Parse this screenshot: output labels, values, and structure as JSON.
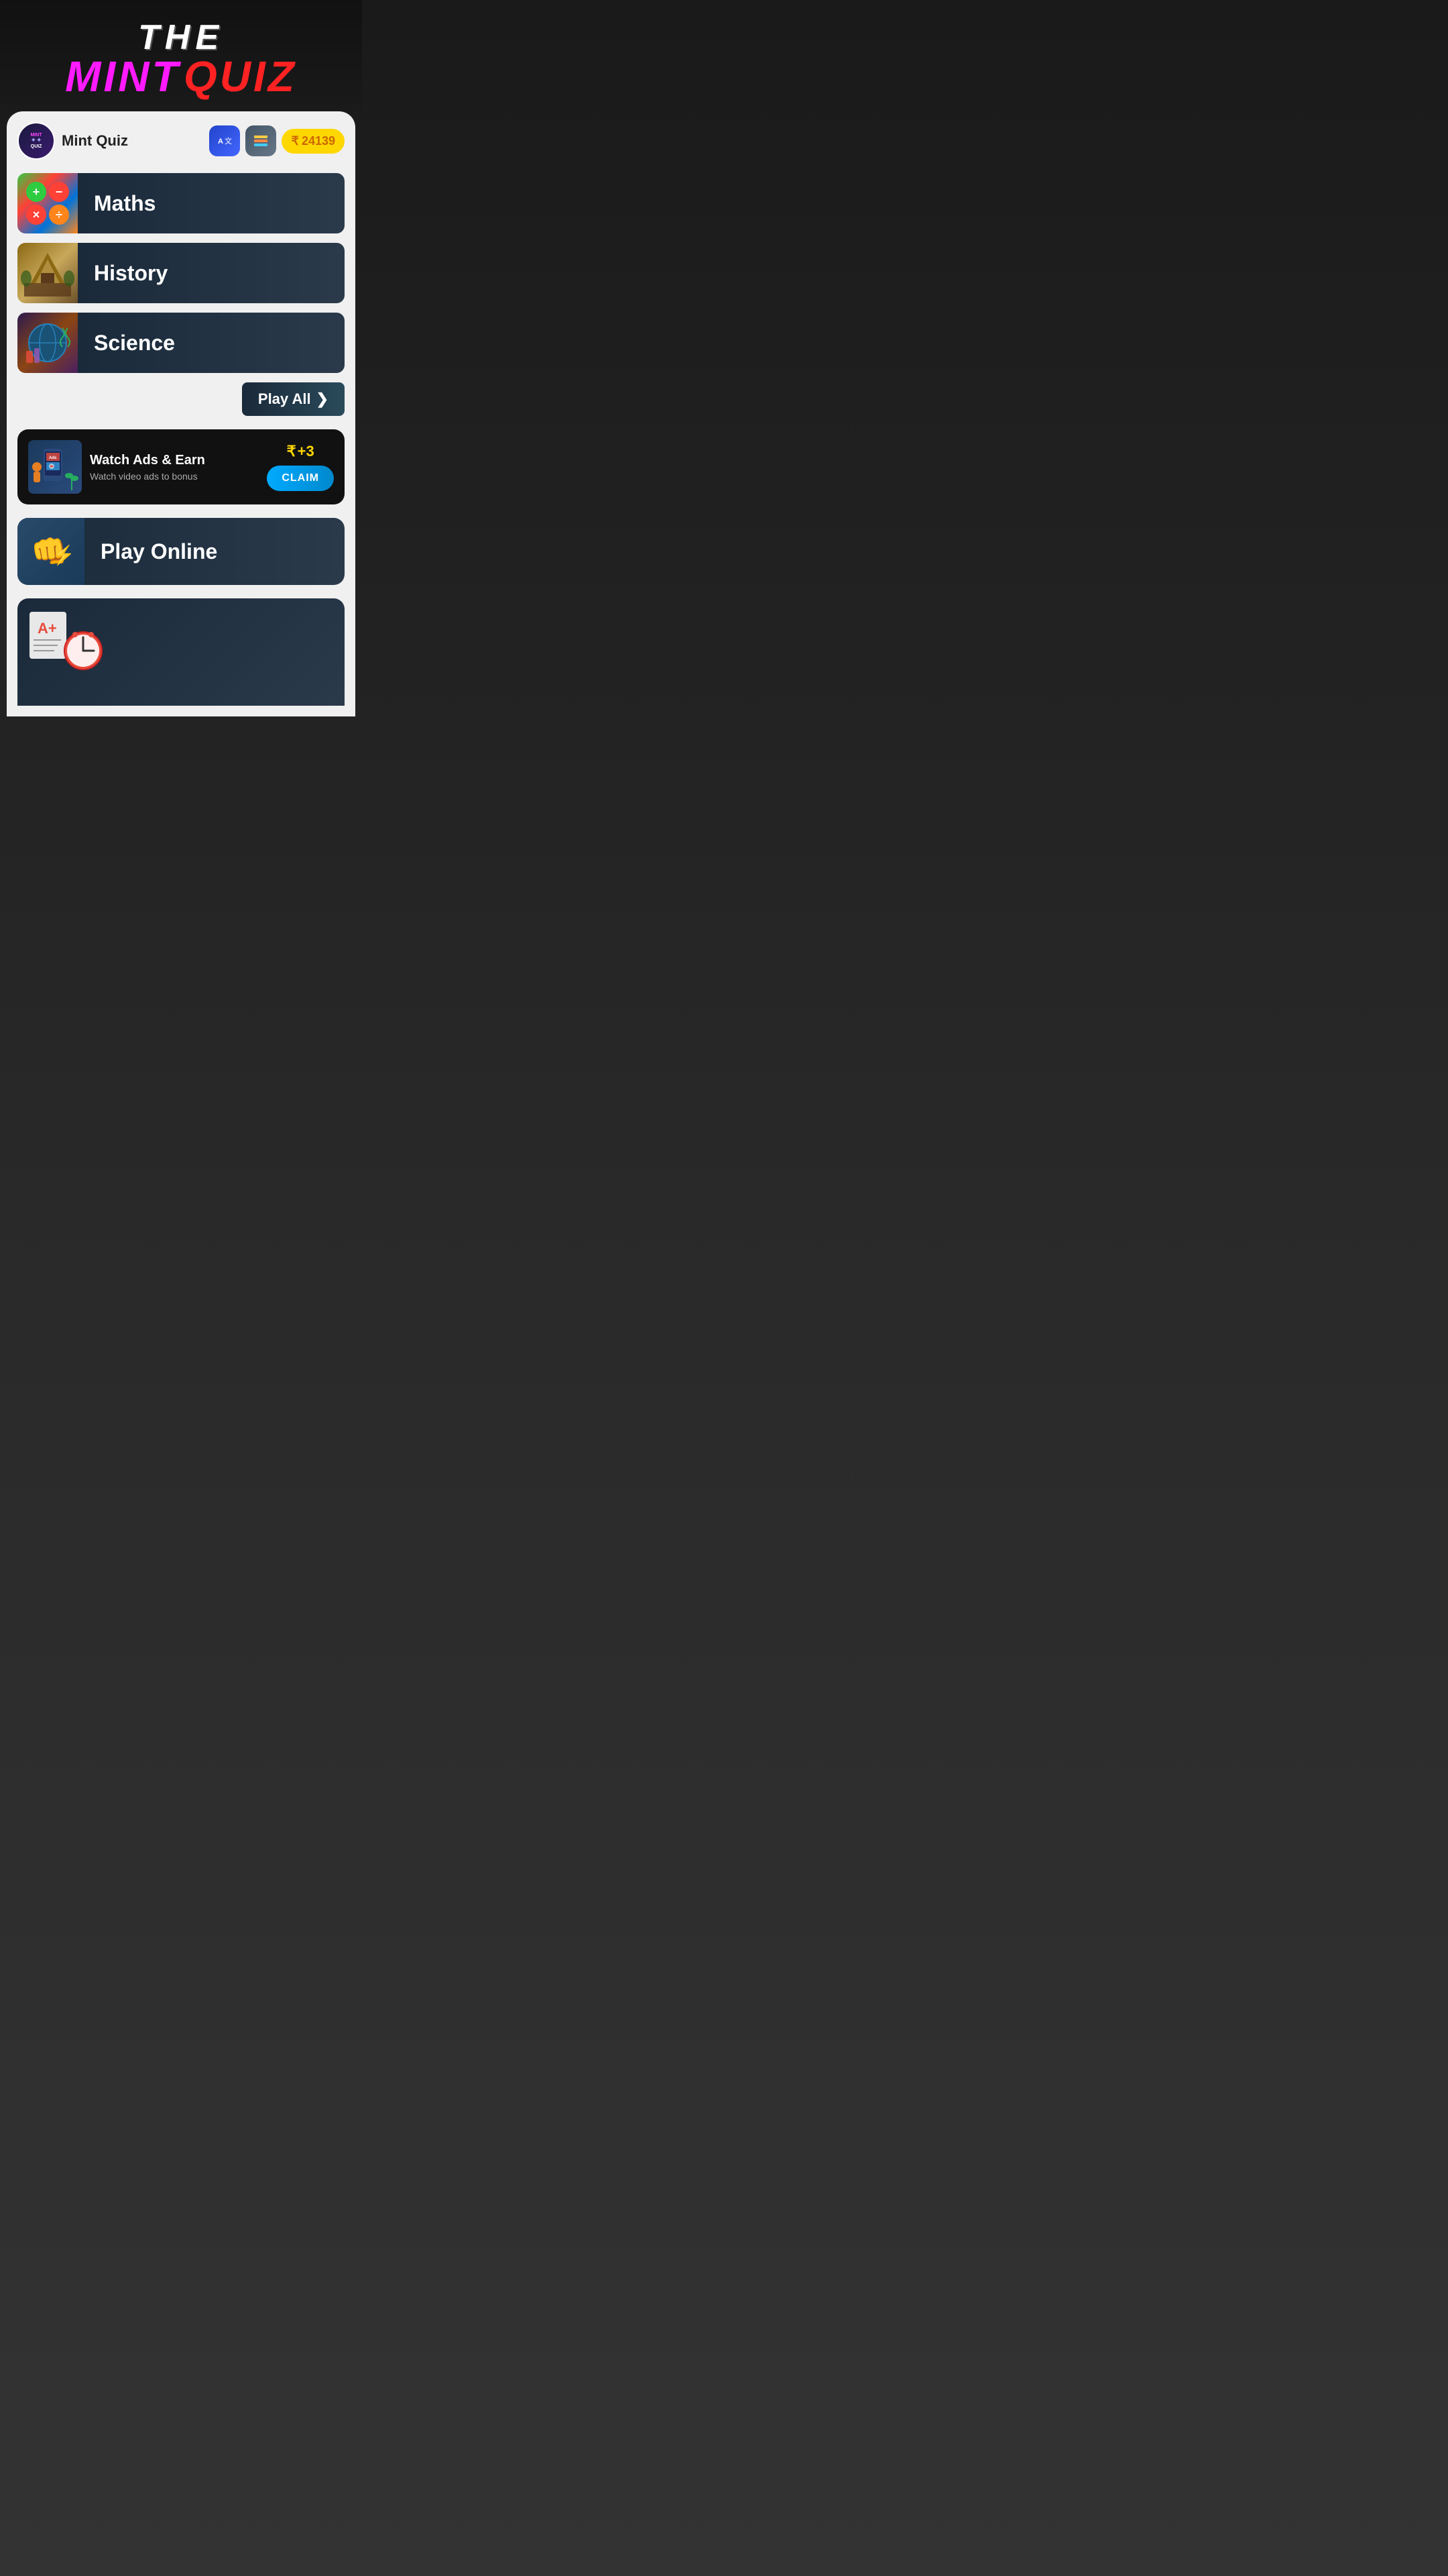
{
  "header": {
    "the_label": "THE",
    "mint_label": "MINT",
    "quiz_label": "QUIZ"
  },
  "topbar": {
    "app_name": "Mint Quiz",
    "coins": "24139",
    "coin_symbol": "₹",
    "translate_icon": "A↔",
    "store_icon": "🏪"
  },
  "categories": [
    {
      "id": "maths",
      "label": "Maths",
      "icon_type": "maths_grid"
    },
    {
      "id": "history",
      "label": "History",
      "icon_type": "history_image"
    },
    {
      "id": "science",
      "label": "Science",
      "icon_type": "science_image"
    }
  ],
  "play_all": {
    "label": "Play All",
    "arrow": "❯"
  },
  "ads_card": {
    "title": "Watch Ads & Earn",
    "subtitle": "Watch video ads to bonus",
    "bonus_symbol": "₹",
    "bonus_amount": "+3",
    "claim_label": "CLAIM"
  },
  "play_online": {
    "label": "Play Online"
  },
  "maths_symbols": {
    "plus": "+",
    "minus": "−",
    "times": "×",
    "divide": "÷"
  }
}
